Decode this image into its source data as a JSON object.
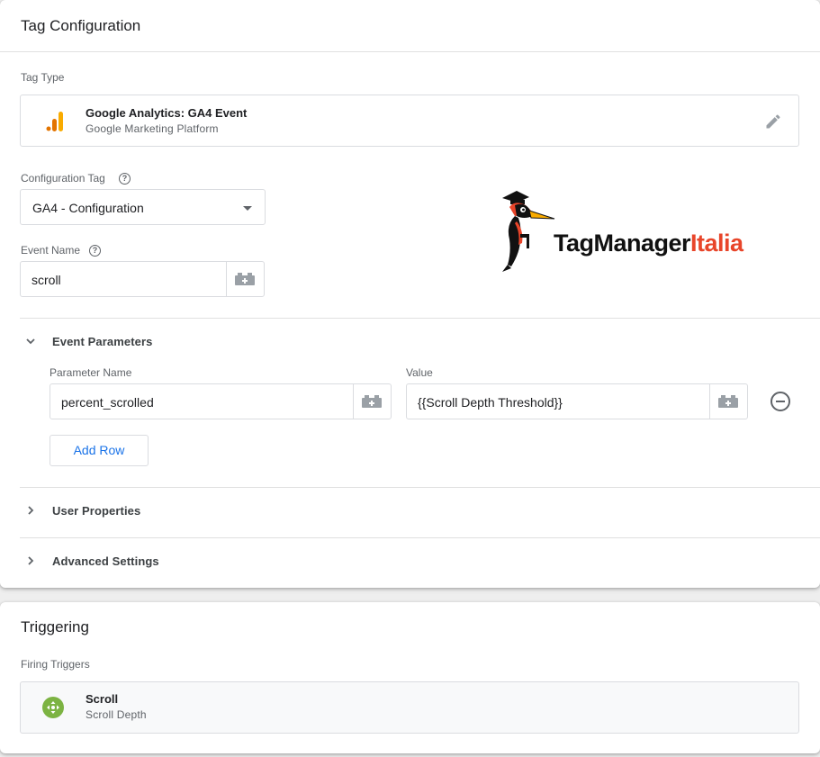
{
  "tag_config": {
    "title": "Tag Configuration",
    "tag_type_label": "Tag Type",
    "tag_type": {
      "name": "Google Analytics: GA4 Event",
      "platform": "Google Marketing Platform",
      "icon": "analytics-bar-icon",
      "color": "#f9ab00"
    },
    "config_tag": {
      "label": "Configuration Tag",
      "help": "?",
      "value": "GA4 - Configuration"
    },
    "event_name": {
      "label": "Event Name",
      "help": "?",
      "value": "scroll"
    },
    "event_parameters": {
      "label": "Event Parameters",
      "expanded": true,
      "param_name_header": "Parameter Name",
      "value_header": "Value",
      "rows": [
        {
          "name": "percent_scrolled",
          "value": "{{Scroll Depth Threshold}}"
        }
      ],
      "add_row_label": "Add Row"
    },
    "user_properties": {
      "label": "User Properties",
      "expanded": false
    },
    "advanced_settings": {
      "label": "Advanced Settings",
      "expanded": false
    }
  },
  "logo": {
    "text_dark": "TagManager",
    "text_accent": "Italia",
    "accent_color": "#e8452a"
  },
  "triggering": {
    "title": "Triggering",
    "firing_label": "Firing Triggers",
    "trigger": {
      "name": "Scroll",
      "type": "Scroll Depth",
      "icon": "scroll-move-icon",
      "color": "#7cb342"
    }
  }
}
